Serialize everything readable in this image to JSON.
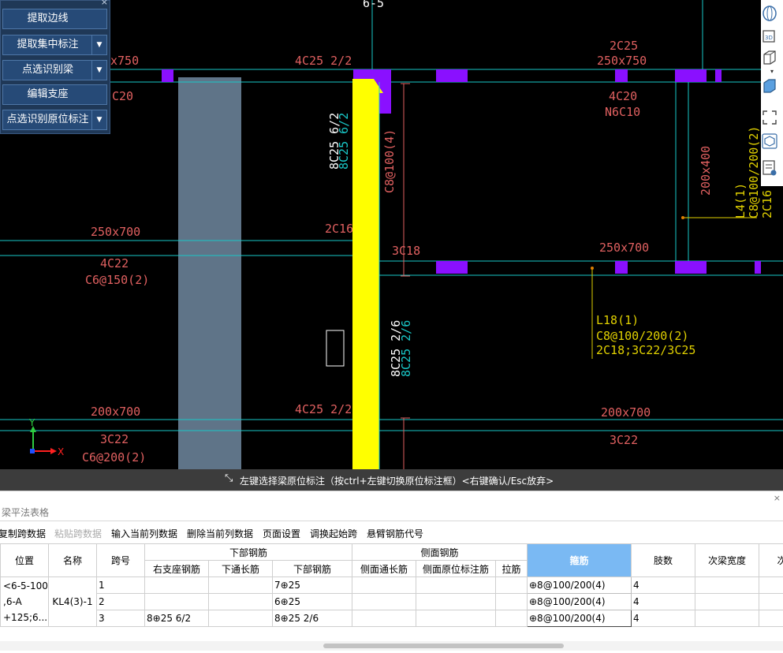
{
  "tool_panel": {
    "close": "×",
    "buttons": [
      {
        "label": "提取边线",
        "has_dropdown": false
      },
      {
        "label": "提取集中标注",
        "has_dropdown": true
      },
      {
        "label": "点选识别梁",
        "has_dropdown": true
      },
      {
        "label": "编辑支座",
        "has_dropdown": false
      },
      {
        "label": "点选识别原位标注",
        "has_dropdown": true
      }
    ]
  },
  "drawing": {
    "section_mark": "6-5",
    "axis": {
      "y": "Y",
      "x": "X"
    },
    "labels": {
      "t1": "x750",
      "t2": "4C25 2/2",
      "t3": "2C25",
      "t4": "250x750",
      "t5": "C20",
      "t6": "4C20",
      "t7": "N6C10",
      "t8": "8C25 6/2",
      "t9": "8C25 6/2",
      "t10": "C8@100(4)",
      "t11": "200x400",
      "t12": "L4(1)",
      "t13": "C8@100/200(2)",
      "t14": "2C16",
      "t15": "250x700",
      "t16": "2C16",
      "t17": "3C18",
      "t18": "250x700",
      "t19": "4C22",
      "t20": "C6@150(2)",
      "t21": "L18(1)",
      "t22": "C8@100/200(2)",
      "t23": "2C18;3C22/3C25",
      "t24": "8C25 2/6",
      "t25": "8C25 2/6",
      "t26": "200x700",
      "t27": "4C25 2/2",
      "t28": "200x700",
      "t29": "3C22",
      "t30": "C6@200(2)",
      "t31": "3C22"
    }
  },
  "status_bar": {
    "text": "左键选择梁原位标注（按ctrl+左键切换原位标注框）<右键确认/Esc放弃>"
  },
  "panel": {
    "title": "梁平法表格",
    "close": "×",
    "toolbar": [
      {
        "label": "复制跨数据",
        "disabled": false
      },
      {
        "label": "粘贴跨数据",
        "disabled": true
      },
      {
        "label": "输入当前列数据",
        "disabled": false
      },
      {
        "label": "删除当前列数据",
        "disabled": false
      },
      {
        "label": "页面设置",
        "disabled": false
      },
      {
        "label": "调换起始跨",
        "disabled": false
      },
      {
        "label": "悬臂钢筋代号",
        "disabled": false
      }
    ]
  },
  "table": {
    "headers": {
      "position": "位置",
      "name": "名称",
      "span": "跨号",
      "bottom_group": "下部钢筋",
      "side_group": "侧面钢筋",
      "stirrup": "箍筋",
      "legs": "肢数",
      "sec_width": "次梁宽度",
      "sec_cut": "次"
    },
    "subheaders": {
      "right_support": "右支座钢筋",
      "bottom_through": "下通长筋",
      "bottom_rebar": "下部钢筋",
      "side_through": "侧面通长筋",
      "side_inplace": "侧面原位标注筋",
      "tie": "拉筋"
    },
    "position_lines": [
      "<6-5-100",
      ",6-A",
      "+125;6..."
    ],
    "name": "KL4(3)-1",
    "rows": [
      {
        "span": "1",
        "right_support": "",
        "bottom_through": "",
        "bottom_rebar": "7⊕25",
        "side_through": "",
        "side_inplace": "",
        "tie": "",
        "stirrup": "⊕8@100/200(4)",
        "legs": "4"
      },
      {
        "span": "2",
        "right_support": "",
        "bottom_through": "",
        "bottom_rebar": "6⊕25",
        "side_through": "",
        "side_inplace": "",
        "tie": "",
        "stirrup": "⊕8@100/200(4)",
        "legs": "4"
      },
      {
        "span": "3",
        "right_support": "8⊕25 6/2",
        "bottom_through": "",
        "bottom_rebar": "8⊕25 2/6",
        "side_through": "",
        "side_inplace": "",
        "tie": "",
        "stirrup": "⊕8@100/200(4)",
        "legs": "4"
      }
    ]
  }
}
